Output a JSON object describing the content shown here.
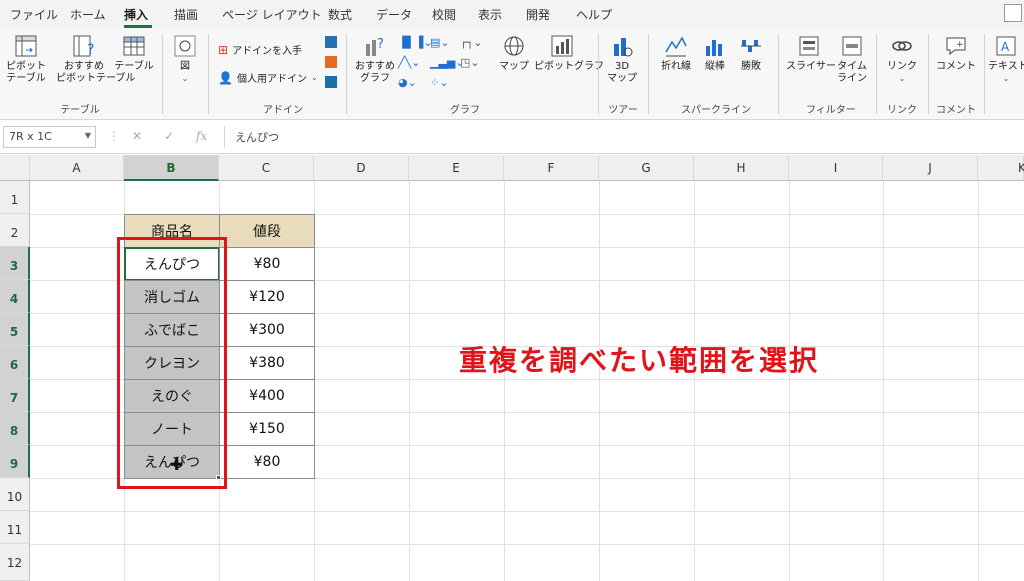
{
  "tabs": [
    "ファイル",
    "ホーム",
    "挿入",
    "描画",
    "ページ レイアウト",
    "数式",
    "データ",
    "校閲",
    "表示",
    "開発",
    "ヘルプ"
  ],
  "active_tab": "挿入",
  "ribbon": {
    "pivot_table": "ピボット\nテーブル",
    "recommended_pivot": "おすすめ\nピボットテーブル",
    "table": "テーブル",
    "group_table": "テーブル",
    "illustrations": "図",
    "get_addins": "アドインを入手",
    "my_addins": "個人用アドイン",
    "group_addins": "アドイン",
    "recommended_charts": "おすすめ\nグラフ",
    "maps": "マップ",
    "pivot_chart": "ピボットグラフ",
    "group_charts": "グラフ",
    "map3d": "3D\nマップ",
    "group_tours": "ツアー",
    "spark_line": "折れ線",
    "spark_column": "縦棒",
    "spark_winloss": "勝敗",
    "group_sparklines": "スパークライン",
    "slicer": "スライサー",
    "timeline": "タイム\nライン",
    "group_filters": "フィルター",
    "link": "リンク",
    "group_links": "リンク",
    "comment": "コメント",
    "group_comments": "コメント",
    "text": "テキスト"
  },
  "formula_bar": {
    "name_box": "7R x 1C",
    "cancel": "✕",
    "enter": "✓",
    "fx": "fx",
    "content": "えんぴつ"
  },
  "columns": [
    "A",
    "B",
    "C",
    "D",
    "E",
    "F",
    "G",
    "H",
    "I",
    "J",
    "K"
  ],
  "rows": [
    "1",
    "2",
    "3",
    "4",
    "5",
    "6",
    "7",
    "8",
    "9",
    "10",
    "11",
    "12"
  ],
  "table": {
    "header_name": "商品名",
    "header_price": "値段",
    "items": [
      {
        "name": "えんぴつ",
        "price": "¥80"
      },
      {
        "name": "消しゴム",
        "price": "¥120"
      },
      {
        "name": "ふでばこ",
        "price": "¥300"
      },
      {
        "name": "クレヨン",
        "price": "¥380"
      },
      {
        "name": "えのぐ",
        "price": "¥400"
      },
      {
        "name": "ノート",
        "price": "¥150"
      },
      {
        "name": "えんぴつ",
        "price": "¥80"
      }
    ]
  },
  "annotation": "重複を調べたい範囲を選択",
  "colors": {
    "accent_green": "#1e7145",
    "annotation_red": "#e0141a",
    "header_fill": "#e9dcbd",
    "selection_fill": "#c4c4c4"
  }
}
